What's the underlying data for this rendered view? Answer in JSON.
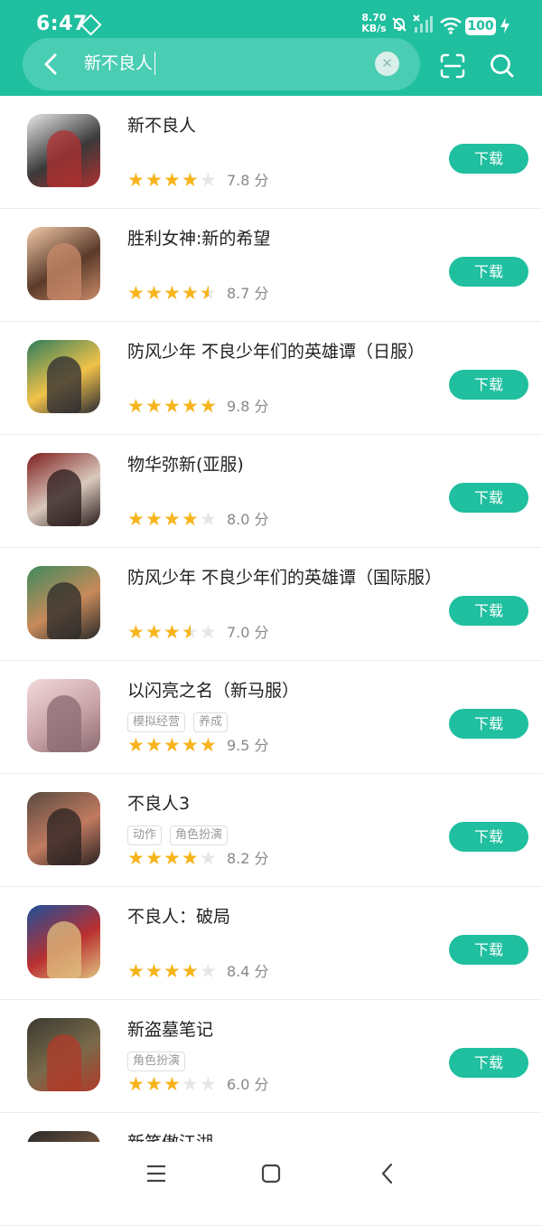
{
  "status": {
    "time": "6:47",
    "net_speed_value": "8.70",
    "net_speed_unit": "KB/s",
    "battery": "100"
  },
  "search": {
    "query": "新不良人"
  },
  "apps": [
    {
      "title": "新不良人",
      "tags": [],
      "rating": 4,
      "score": "7.8 分",
      "download_label": "下载",
      "icon_colors": [
        "#e8e8e8",
        "#3a3a3a",
        "#b03030"
      ]
    },
    {
      "title": "胜利女神:新的希望",
      "tags": [],
      "rating": 4.5,
      "score": "8.7 分",
      "download_label": "下载",
      "icon_colors": [
        "#f3c9a8",
        "#5a3a2a",
        "#c98a6a"
      ]
    },
    {
      "title": "防风少年 不良少年们的英雄谭（日服）",
      "tags": [],
      "rating": 5,
      "score": "9.8 分",
      "download_label": "下载",
      "icon_colors": [
        "#2f7d5c",
        "#f1c24a",
        "#2a2a33"
      ]
    },
    {
      "title": "物华弥新(亚服)",
      "tags": [],
      "rating": 4,
      "score": "8.0 分",
      "download_label": "下载",
      "icon_colors": [
        "#7e1e1e",
        "#d9c9bd",
        "#2a1a1a"
      ]
    },
    {
      "title": "防风少年 不良少年们的英雄谭（国际服）",
      "tags": [],
      "rating": 3.5,
      "score": "7.0 分",
      "download_label": "下载",
      "icon_colors": [
        "#3f8a5e",
        "#c78a5a",
        "#2a2a2a"
      ]
    },
    {
      "title": "以闪亮之名（新马服）",
      "tags": [
        "模拟经营",
        "养成"
      ],
      "rating": 5,
      "score": "9.5 分",
      "download_label": "下载",
      "icon_colors": [
        "#f2d9da",
        "#c9a3a8",
        "#8a6a70"
      ]
    },
    {
      "title": "不良人3",
      "tags": [
        "动作",
        "角色扮演"
      ],
      "rating": 4,
      "score": "8.2 分",
      "download_label": "下载",
      "icon_colors": [
        "#5a4a40",
        "#c07a60",
        "#2a2222"
      ]
    },
    {
      "title": "不良人：破局",
      "tags": [],
      "rating": 4,
      "score": "8.4 分",
      "download_label": "下载",
      "icon_colors": [
        "#1e4f9a",
        "#b93030",
        "#e0c080"
      ]
    },
    {
      "title": "新盗墓笔记",
      "tags": [
        "角色扮演"
      ],
      "rating": 3,
      "score": "6.0 分",
      "download_label": "下载",
      "icon_colors": [
        "#3a3a32",
        "#7a6a4a",
        "#b03a2a"
      ]
    },
    {
      "title": "新笑傲江湖",
      "tags": [],
      "rating": 0,
      "score": "",
      "download_label": "",
      "icon_colors": [
        "#2a2a2a",
        "#7a5a40",
        "#3a3030"
      ]
    }
  ],
  "icons": {
    "back": "back-arrow-icon",
    "clear": "clear-icon",
    "scan": "scan-icon",
    "search": "search-icon",
    "star": "star-icon",
    "nav_menu": "menu-icon",
    "nav_home": "home-icon",
    "nav_back": "back-icon"
  },
  "colors": {
    "accent": "#1fbf9f",
    "star": "#f8b41a",
    "star_empty": "#e6e6e6"
  }
}
